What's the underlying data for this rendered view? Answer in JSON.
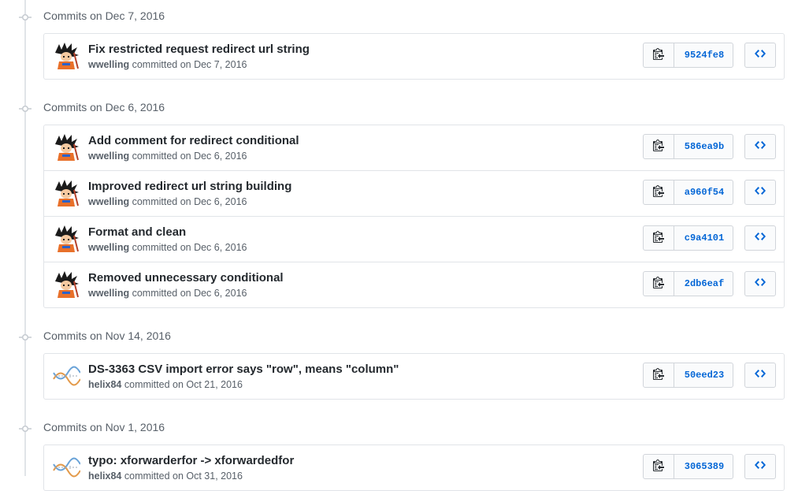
{
  "groups": [
    {
      "title": "Commits on Dec 7, 2016",
      "commits": [
        {
          "title": "Fix restricted request redirect url string",
          "author": "wwelling",
          "committed": "committed on Dec 7, 2016",
          "sha": "9524fe8",
          "avatar": "goku-avatar"
        }
      ]
    },
    {
      "title": "Commits on Dec 6, 2016",
      "commits": [
        {
          "title": "Add comment for redirect conditional",
          "author": "wwelling",
          "committed": "committed on Dec 6, 2016",
          "sha": "586ea9b",
          "avatar": "goku-avatar"
        },
        {
          "title": "Improved redirect url string building",
          "author": "wwelling",
          "committed": "committed on Dec 6, 2016",
          "sha": "a960f54",
          "avatar": "goku-avatar"
        },
        {
          "title": "Format and clean",
          "author": "wwelling",
          "committed": "committed on Dec 6, 2016",
          "sha": "c9a4101",
          "avatar": "goku-avatar"
        },
        {
          "title": "Removed unnecessary conditional",
          "author": "wwelling",
          "committed": "committed on Dec 6, 2016",
          "sha": "2db6eaf",
          "avatar": "goku-avatar"
        }
      ]
    },
    {
      "title": "Commits on Nov 14, 2016",
      "commits": [
        {
          "title": "DS-3363 CSV import error says \"row\", means \"column\"",
          "author": "helix84",
          "committed": "committed on Oct 21, 2016",
          "sha": "50eed23",
          "avatar": "dna-avatar"
        }
      ]
    },
    {
      "title": "Commits on Nov 1, 2016",
      "commits": [
        {
          "title": "typo: xforwarderfor -> xforwardedfor",
          "author": "helix84",
          "committed": "committed on Oct 31, 2016",
          "sha": "3065389",
          "avatar": "dna-avatar"
        }
      ]
    }
  ],
  "icons": {
    "copy": "clipboard-icon",
    "browse": "code-icon",
    "timeline": "git-commit-icon"
  },
  "colors": {
    "link": "#0366d6",
    "muted": "#586069",
    "border": "#e1e4e8"
  }
}
